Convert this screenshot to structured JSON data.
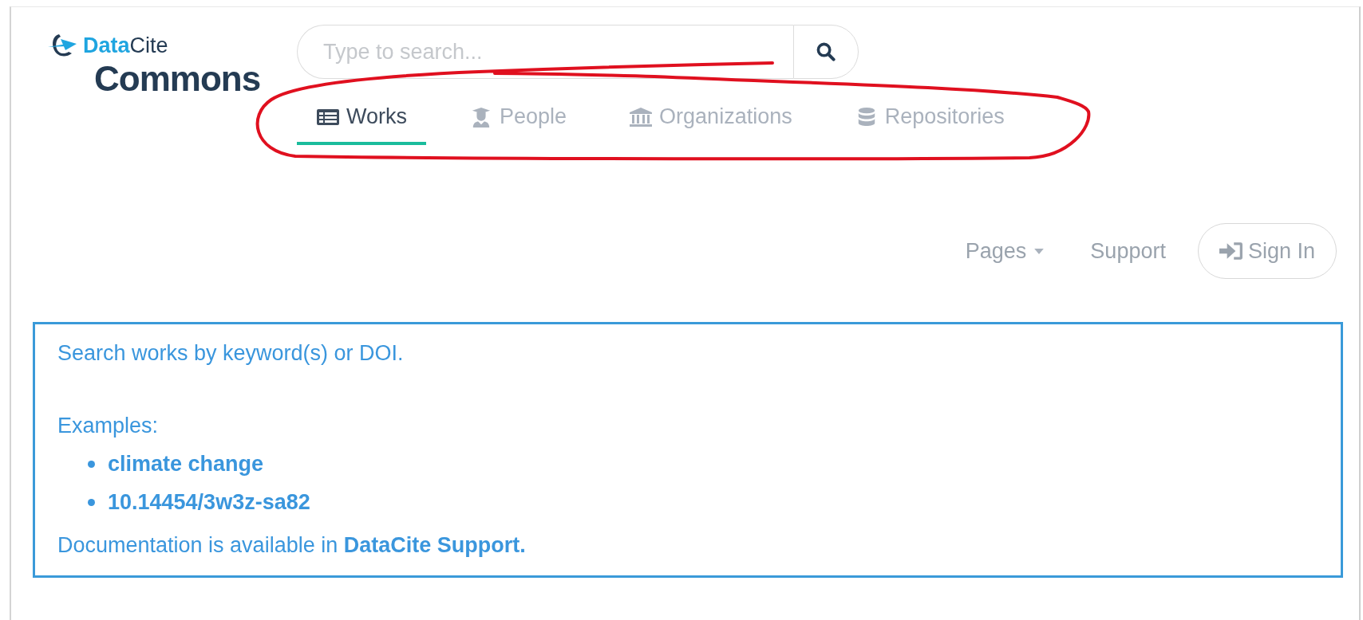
{
  "logo": {
    "brand_primary": "Data",
    "brand_secondary": "Cite",
    "product": "Commons"
  },
  "search": {
    "placeholder": "Type to search..."
  },
  "tabs": [
    {
      "label": "Works",
      "kind": "works",
      "selected": true
    },
    {
      "label": "People",
      "kind": "people",
      "selected": false
    },
    {
      "label": "Organizations",
      "kind": "organizations",
      "selected": false
    },
    {
      "label": "Repositories",
      "kind": "repositories",
      "selected": false
    }
  ],
  "nav": {
    "pages": "Pages",
    "support": "Support",
    "sign_in": "Sign In"
  },
  "info": {
    "intro": "Search works by keyword(s) or DOI.",
    "examples_label": "Examples:",
    "examples": [
      "climate change",
      "10.14454/3w3z-sa82"
    ],
    "documentation_text": "Documentation is available in",
    "documentation_link": "DataCite Support."
  }
}
